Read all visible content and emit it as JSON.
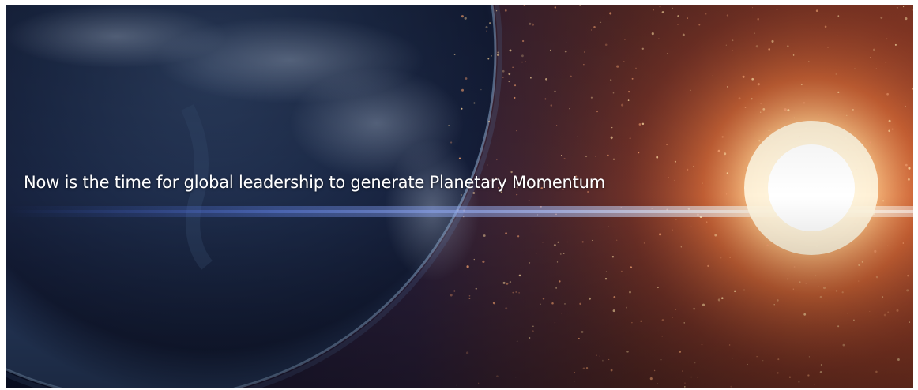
{
  "hero": {
    "headline": "Now is the time for global leadership to generate Planetary Momentum",
    "colors": {
      "space_dark": "#0d1430",
      "space_warm": "#6b2a22",
      "sun_core": "#fff6e0",
      "sun_glow": "#f0783c",
      "flare_blue": "#5f7fe0",
      "planet_edge": "#8fb3d9",
      "headline_text": "#ffffff"
    }
  }
}
